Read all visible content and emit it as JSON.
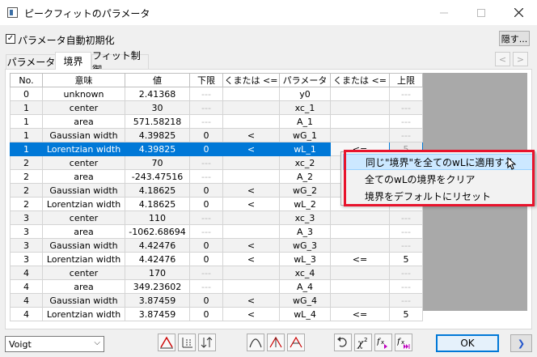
{
  "window": {
    "title": "ピークフィットのパラメータ"
  },
  "options": {
    "auto_init_label": "パラメータ自動初期化",
    "auto_init_checked": true,
    "hide_button": "隠す..."
  },
  "tabs": [
    {
      "label": "パラメータ",
      "active": false
    },
    {
      "label": "境界",
      "active": true
    },
    {
      "label": "フィット制御",
      "active": false
    }
  ],
  "table": {
    "headers": [
      "No.",
      "意味",
      "値",
      "下限",
      "くまたは <=",
      "パラメータ",
      "くまたは <=",
      "上限"
    ],
    "rows": [
      [
        "0",
        "unknown",
        "2.41368",
        "---",
        "",
        "y0",
        "",
        "---"
      ],
      [
        "1",
        "center",
        "30",
        "---",
        "",
        "xc_1",
        "",
        "---"
      ],
      [
        "1",
        "area",
        "571.58218",
        "---",
        "",
        "A_1",
        "",
        "---"
      ],
      [
        "1",
        "Gaussian width",
        "4.39825",
        "0",
        "<",
        "wG_1",
        "",
        "---"
      ],
      [
        "1",
        "Lorentzian width",
        "4.39825",
        "0",
        "<",
        "wL_1",
        "<=",
        "5"
      ],
      [
        "2",
        "center",
        "70",
        "---",
        "",
        "xc_2",
        "",
        "---"
      ],
      [
        "2",
        "area",
        "-243.47516",
        "---",
        "",
        "A_2",
        "",
        "---"
      ],
      [
        "2",
        "Gaussian width",
        "4.18625",
        "0",
        "<",
        "wG_2",
        "",
        "---"
      ],
      [
        "2",
        "Lorentzian width",
        "4.18625",
        "0",
        "<",
        "wL_2",
        "",
        "---"
      ],
      [
        "3",
        "center",
        "110",
        "---",
        "",
        "xc_3",
        "",
        "---"
      ],
      [
        "3",
        "area",
        "-1062.68694",
        "---",
        "",
        "A_3",
        "",
        "---"
      ],
      [
        "3",
        "Gaussian width",
        "4.42476",
        "0",
        "<",
        "wG_3",
        "",
        "---"
      ],
      [
        "3",
        "Lorentzian width",
        "4.42476",
        "0",
        "<",
        "wL_3",
        "<=",
        "5"
      ],
      [
        "4",
        "center",
        "170",
        "---",
        "",
        "xc_4",
        "",
        "---"
      ],
      [
        "4",
        "area",
        "349.23602",
        "---",
        "",
        "A_4",
        "",
        "---"
      ],
      [
        "4",
        "Gaussian width",
        "3.87459",
        "0",
        "<",
        "wG_4",
        "",
        "---"
      ],
      [
        "4",
        "Lorentzian width",
        "3.87459",
        "0",
        "<",
        "wL_4",
        "<=",
        "5"
      ]
    ]
  },
  "context_menu": {
    "items": [
      {
        "label": "同じ\"境界\"を全てのwLに適用する"
      },
      {
        "label": "全てのwLの境界をクリア"
      },
      {
        "label": "境界をデフォルトにリセット"
      }
    ]
  },
  "footer": {
    "profile_select": "Voigt",
    "ok_label": "OK"
  },
  "colors": {
    "selection": "#0078d7",
    "highlight_box": "#e8132c",
    "grid_background": "#a9a9a9"
  }
}
